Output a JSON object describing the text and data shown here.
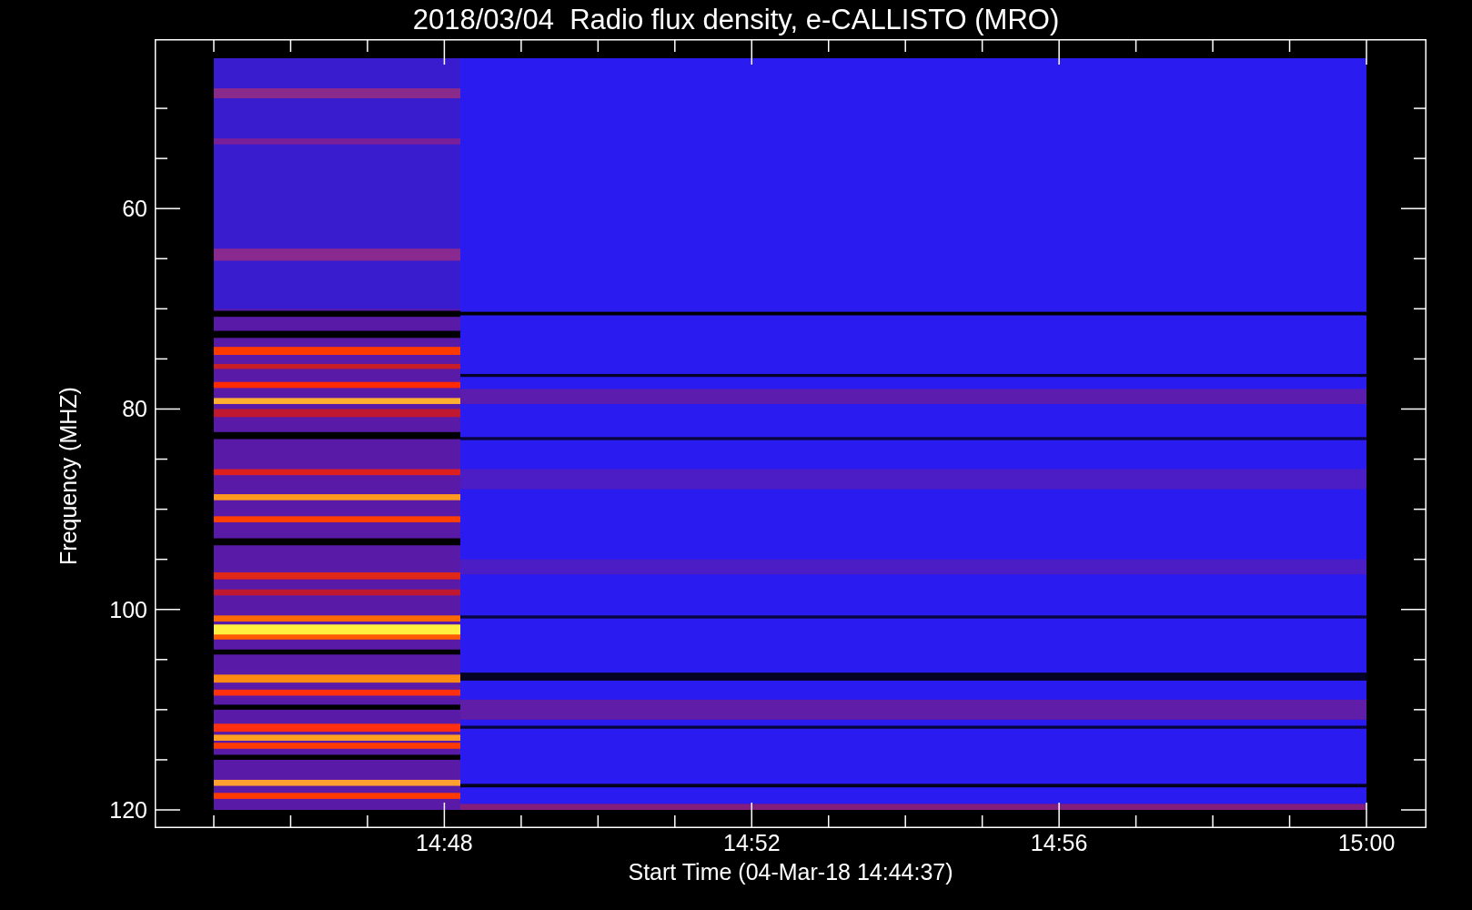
{
  "title": "2018/03/04  Radio flux density, e-CALLISTO (MRO)",
  "y_axis": {
    "label": "Frequency (MHZ)",
    "ticks": [
      "60",
      "80",
      "100",
      "120"
    ]
  },
  "x_axis": {
    "label": "Start Time (04-Mar-18 14:44:37)",
    "ticks": [
      "14:48",
      "14:52",
      "14:56",
      "15:00"
    ]
  }
}
